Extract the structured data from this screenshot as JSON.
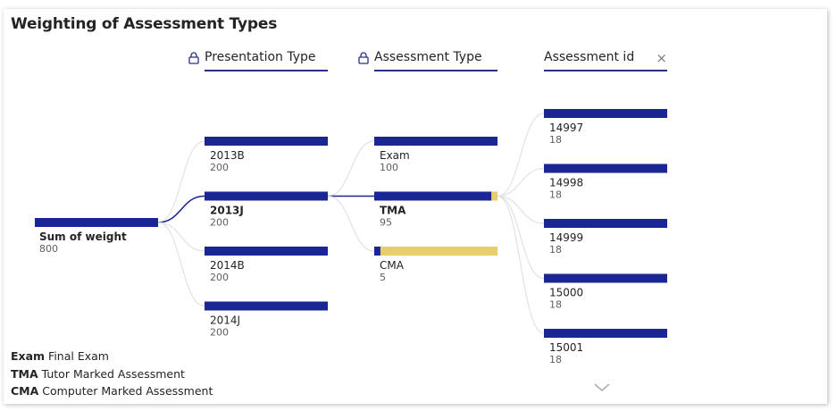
{
  "title": "Weighting of Assessment Types",
  "columns": [
    {
      "label": "Presentation Type",
      "locked": true
    },
    {
      "label": "Assessment Type",
      "locked": true
    },
    {
      "label": "Assessment id",
      "closable": true
    }
  ],
  "colors": {
    "bar": "#1a2694",
    "remainder": "#e6cf6b",
    "link": "#e2e2e2",
    "active_link": "#1a2694",
    "header_line": "#2a2f86"
  },
  "chart_data": {
    "type": "decomposition-tree",
    "root": {
      "label": "Sum of weight",
      "value": 800
    },
    "levels": [
      {
        "field": "Presentation Type",
        "selected": "2013J",
        "nodes": [
          {
            "label": "2013B",
            "value": 200
          },
          {
            "label": "2013J",
            "value": 200
          },
          {
            "label": "2014B",
            "value": 200
          },
          {
            "label": "2014J",
            "value": 200
          }
        ]
      },
      {
        "field": "Assessment Type",
        "selected": "TMA",
        "nodes": [
          {
            "label": "Exam",
            "value": 100
          },
          {
            "label": "TMA",
            "value": 95
          },
          {
            "label": "CMA",
            "value": 5
          }
        ]
      },
      {
        "field": "Assessment id",
        "nodes": [
          {
            "label": "14997",
            "value": 18
          },
          {
            "label": "14998",
            "value": 18
          },
          {
            "label": "14999",
            "value": 18
          },
          {
            "label": "15000",
            "value": 18
          },
          {
            "label": "15001",
            "value": 18
          }
        ]
      }
    ]
  },
  "legend": [
    {
      "abbr": "Exam",
      "text": "Final Exam"
    },
    {
      "abbr": "TMA",
      "text": "Tutor Marked Assessment"
    },
    {
      "abbr": "CMA",
      "text": "Computer Marked Assessment"
    }
  ],
  "icons": {
    "lock": "lock-icon",
    "close": "close-icon",
    "more": "chevron-down-icon"
  }
}
